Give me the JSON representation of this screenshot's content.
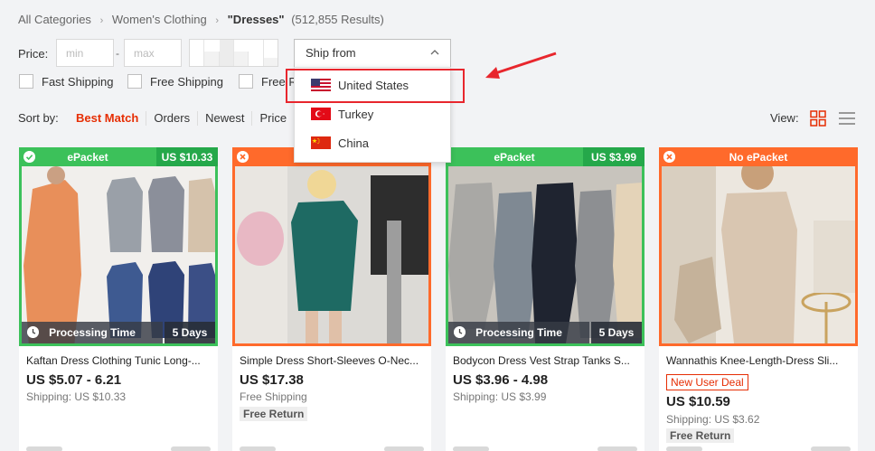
{
  "breadcrumb": {
    "all": "All Categories",
    "category": "Women's Clothing",
    "query": "\"Dresses\"",
    "count": "(512,855 Results)"
  },
  "filters": {
    "price_label": "Price:",
    "min_placeholder": "min",
    "max_placeholder": "max",
    "dash": "-",
    "ship_from_label": "Ship from",
    "ship_options": [
      {
        "label": "United States",
        "flag": "us-flag-icon"
      },
      {
        "label": "Turkey",
        "flag": "turkey-flag-icon"
      },
      {
        "label": "China",
        "flag": "china-flag-icon"
      }
    ],
    "checkboxes": [
      "Fast Shipping",
      "Free Shipping",
      "Free R"
    ]
  },
  "sort": {
    "label": "Sort by:",
    "options": [
      "Best Match",
      "Orders",
      "Newest",
      "Price"
    ],
    "active": "Best Match"
  },
  "view": {
    "label": "View:"
  },
  "colors": {
    "accent": "#e62e04",
    "epacket_green": "#3cc15a",
    "no_epacket_orange": "#ff6a2b",
    "highlight_red": "#e8262d"
  },
  "products": [
    {
      "badge": "ePacket",
      "badge_price": "US $10.33",
      "processing_label": "Processing Time",
      "processing_days": "5 Days",
      "title": "Kaftan Dress Clothing Tunic Long-...",
      "price": "US $5.07 - 6.21",
      "shipping": "Shipping: US $10.33"
    },
    {
      "badge": "",
      "title": "Simple Dress Short-Sleeves O-Nec...",
      "price": "US $17.38",
      "shipping": "Free Shipping",
      "free_return": "Free Return"
    },
    {
      "badge": "ePacket",
      "badge_price": "US $3.99",
      "processing_label": "Processing Time",
      "processing_days": "5 Days",
      "title": "Bodycon Dress Vest Strap Tanks S...",
      "price": "US $3.96 - 4.98",
      "shipping": "Shipping: US $3.99"
    },
    {
      "badge": "No ePacket",
      "title": "Wannathis Knee-Length-Dress Sli...",
      "new_user": "New User Deal",
      "price": "US $10.59",
      "shipping": "Shipping: US $3.62",
      "free_return": "Free Return"
    }
  ]
}
